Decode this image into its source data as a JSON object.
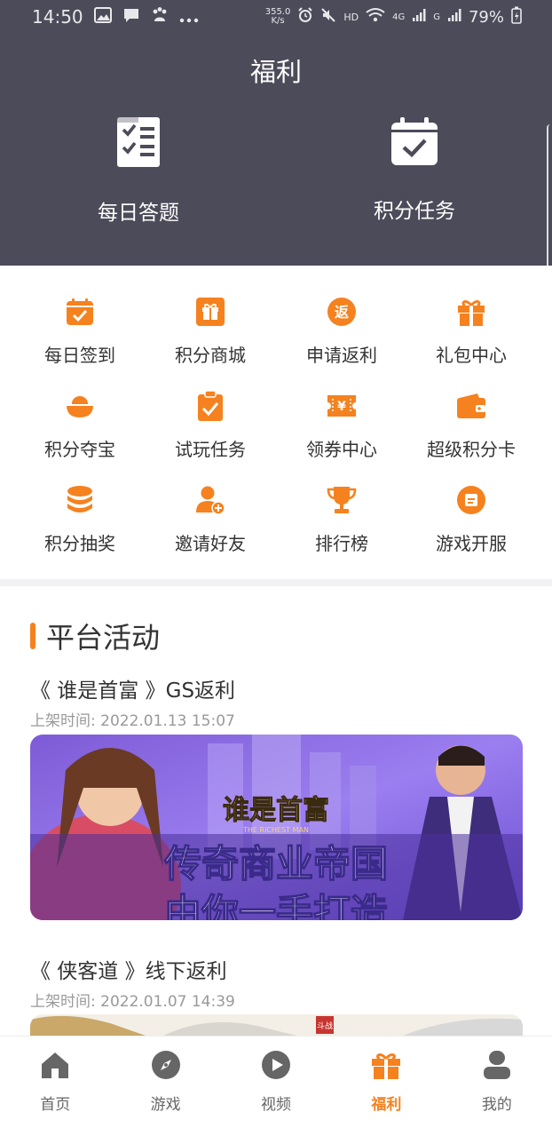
{
  "status_bar": {
    "time": "14:50",
    "net_speed": "355.0",
    "net_unit": "K/s",
    "hd": "HD",
    "signal_4g": "4G",
    "signal_g": "G",
    "battery": "79%"
  },
  "header": {
    "title": "福利",
    "hero": [
      {
        "label": "每日答题",
        "icon": "quiz-checklist-icon"
      },
      {
        "label": "积分任务",
        "icon": "calendar-check-icon"
      }
    ]
  },
  "grid": [
    {
      "label": "每日签到",
      "icon": "calendar-check-icon"
    },
    {
      "label": "积分商城",
      "icon": "gift-box-icon"
    },
    {
      "label": "申请返利",
      "icon": "rebate-icon"
    },
    {
      "label": "礼包中心",
      "icon": "gift-icon"
    },
    {
      "label": "积分夺宝",
      "icon": "gold-ingot-icon"
    },
    {
      "label": "试玩任务",
      "icon": "clipboard-check-icon"
    },
    {
      "label": "领券中心",
      "icon": "coupon-icon"
    },
    {
      "label": "超级积分卡",
      "icon": "wallet-icon"
    },
    {
      "label": "积分抽奖",
      "icon": "coin-stack-icon"
    },
    {
      "label": "邀请好友",
      "icon": "add-user-icon"
    },
    {
      "label": "排行榜",
      "icon": "trophy-icon"
    },
    {
      "label": "游戏开服",
      "icon": "server-icon"
    }
  ],
  "rebate_glyph": "返",
  "coupon_glyph": "¥",
  "section": {
    "title": "平台活动"
  },
  "activities": [
    {
      "title": "《 谁是首富 》GS返利",
      "time": "上架时间: 2022.01.13 15:07",
      "banner_logo": "谁是首富",
      "banner_subtitle": "THE RICHEST MAN",
      "banner_line1": "传奇商业帝国",
      "banner_line2": "由你一手打造"
    },
    {
      "title": "《 侠客道 》线下返利",
      "time": "上架时间: 2022.01.07 14:39",
      "banner_tag": "斗战"
    }
  ],
  "bottom_nav": [
    {
      "label": "首页",
      "icon": "home-icon",
      "active": false
    },
    {
      "label": "游戏",
      "icon": "compass-icon",
      "active": false
    },
    {
      "label": "视频",
      "icon": "play-icon",
      "active": false
    },
    {
      "label": "福利",
      "icon": "gift-icon",
      "active": true
    },
    {
      "label": "我的",
      "icon": "profile-icon",
      "active": false
    }
  ],
  "colors": {
    "accent": "#f5821f",
    "header_bg": "#4c4b59",
    "text": "#333333",
    "muted": "#999999"
  }
}
